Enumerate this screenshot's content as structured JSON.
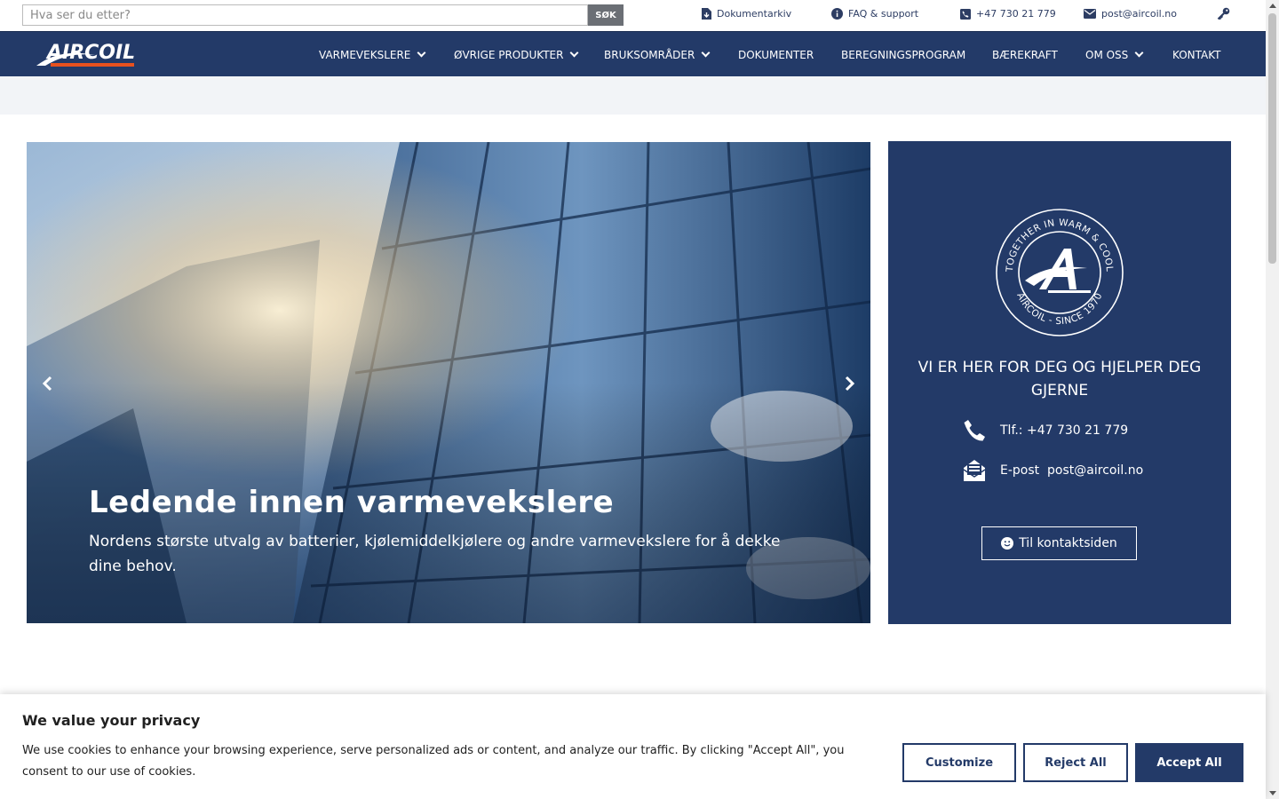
{
  "topbar": {
    "search_placeholder": "Hva ser du etter?",
    "search_button": "SØK",
    "links": {
      "documents": "Dokumentarkiv",
      "faq": "FAQ & support",
      "phone": "+47 730 21 779",
      "email": "post@aircoil.no"
    }
  },
  "nav": {
    "logo_text": "AIRCOIL",
    "items": {
      "heat_exchangers": "VARMEVEKSLERE",
      "other_products": "ØVRIGE PRODUKTER",
      "applications": "BRUKSOMRÅDER",
      "documents": "DOKUMENTER",
      "calc": "BEREGNINGSPROGRAM",
      "sustainability": "BÆREKRAFT",
      "about": "OM OSS",
      "contact": "KONTAKT"
    }
  },
  "hero": {
    "title": "Ledende innen varmevekslere",
    "subtitle": "Nordens største utvalg av batterier, kjølemiddelkjølere og andre varmevekslere for å dekke dine behov."
  },
  "contact": {
    "badge_text_top": "TOGETHER IN WARM & COOL",
    "badge_text_bottom": "AIRCOIL - SINCE 1970",
    "heading": "VI ER HER FOR DEG OG HJELPER DEG GJERNE",
    "phone_label": "Tlf.:",
    "phone": "+47 730 21 779",
    "email_label": "E-post",
    "email": "post@aircoil.no",
    "button": "Til kontaktsiden"
  },
  "cookie": {
    "title": "We value your privacy",
    "text": "We use cookies to enhance your browsing experience, serve personalized ads or content, and analyze our traffic. By clicking \"Accept All\", you consent to our use of cookies.",
    "customize": "Customize",
    "reject": "Reject All",
    "accept": "Accept All"
  },
  "colors": {
    "brand_navy": "#233a68",
    "accent_orange": "#e8511e"
  }
}
